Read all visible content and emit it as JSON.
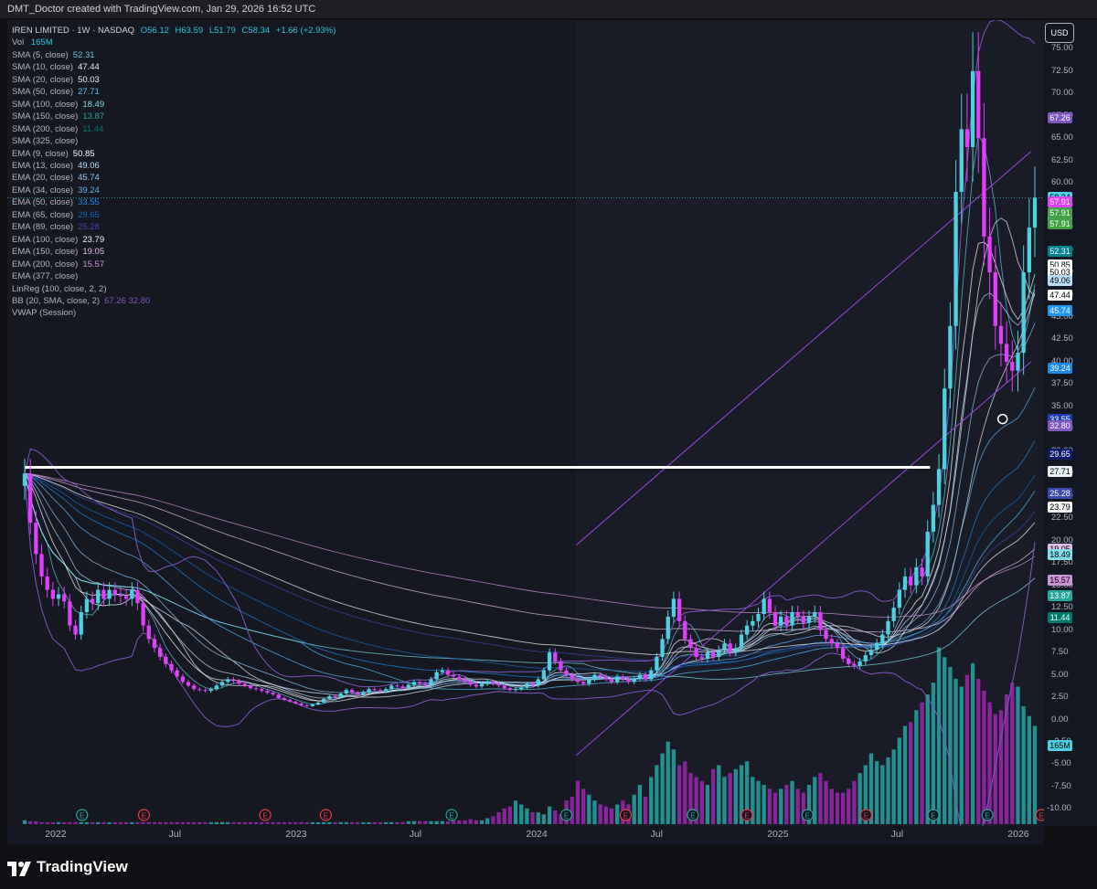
{
  "header": {
    "title": "DMT_Doctor created with TradingView.com, Jan 29, 2026 16:52 UTC"
  },
  "footer": {
    "logo_text": "TradingView"
  },
  "axis": {
    "currency_label": "USD"
  },
  "legend": {
    "symbol": "IREN LIMITED · 1W · NASDAQ",
    "ohlc": {
      "o": "O56.12",
      "h": "H63.59",
      "l": "L51.79",
      "c": "C58.34",
      "chg": "+1.66 (+2.93%)"
    },
    "volume": {
      "label": "Vol",
      "value": "165M"
    },
    "indicators": [
      {
        "label": "SMA (5, close)",
        "value": "52.31",
        "color": "#66c1e0"
      },
      {
        "label": "SMA (10, close)",
        "value": "47.44",
        "color": "#e8f2f5"
      },
      {
        "label": "SMA (20, close)",
        "value": "50.03",
        "color": "#e8f2f5"
      },
      {
        "label": "SMA (50, close)",
        "value": "27.71",
        "color": "#4fc3f7"
      },
      {
        "label": "SMA (100, close)",
        "value": "18.49",
        "color": "#80deea"
      },
      {
        "label": "SMA (150, close)",
        "value": "13.87",
        "color": "#26a69a"
      },
      {
        "label": "SMA (200, close)",
        "value": "11.44",
        "color": "#00796b"
      },
      {
        "label": "SMA (325, close)",
        "value": "",
        "color": "#b2b5be"
      },
      {
        "label": "EMA (9, close)",
        "value": "50.85",
        "color": "#ffffff"
      },
      {
        "label": "EMA (13, close)",
        "value": "49.06",
        "color": "#bbdefb"
      },
      {
        "label": "EMA (20, close)",
        "value": "45.74",
        "color": "#90caf9"
      },
      {
        "label": "EMA (34, close)",
        "value": "39.24",
        "color": "#64b5f6"
      },
      {
        "label": "EMA (50, close)",
        "value": "33.55",
        "color": "#1e88e5"
      },
      {
        "label": "EMA (65, close)",
        "value": "29.65",
        "color": "#1565c0"
      },
      {
        "label": "EMA (89, close)",
        "value": "25.28",
        "color": "#3949ab"
      },
      {
        "label": "EMA (100, close)",
        "value": "23.79",
        "color": "#f5f5f5"
      },
      {
        "label": "EMA (150, close)",
        "value": "19.05",
        "color": "#e1bee7"
      },
      {
        "label": "EMA (200, close)",
        "value": "15.57",
        "color": "#ce93d8"
      },
      {
        "label": "EMA (377, close)",
        "value": "",
        "color": "#b2b5be"
      },
      {
        "label": "LinReg (100, close, 2, 2)",
        "value": "",
        "color": "#b2b5be"
      },
      {
        "label": "BB (20, SMA, close, 2)",
        "value": "67.26  32.80",
        "color": "#7e57c2"
      },
      {
        "label": "VWAP (Session)",
        "value": "",
        "color": "#b2b5be"
      }
    ]
  },
  "colors": {
    "up": "#4dd0e1",
    "down": "#e040fb",
    "vol_up": "#26a6a6",
    "vol_down": "#9c27b0",
    "bb": "#7e57c2",
    "channel": "#9c47e8",
    "level": "#ffffff"
  },
  "chart_data": {
    "type": "candlestick",
    "symbol": "IREN LIMITED",
    "interval": "1W",
    "exchange": "NASDAQ",
    "y_ticks": [
      75,
      72.5,
      70,
      67.5,
      65,
      62.5,
      60,
      57.5,
      55,
      52.5,
      50,
      47.5,
      45,
      42.5,
      40,
      37.5,
      35,
      32.5,
      30,
      27.5,
      25,
      22.5,
      20,
      17.5,
      15,
      12.5,
      10,
      7.5,
      5,
      2.5,
      0,
      -2.5,
      -5,
      -7.5,
      -10
    ],
    "y_tick_labels": [
      "75.00",
      "72.50",
      "70.00",
      "67.50",
      "65.00",
      "62.50",
      "60.00",
      "57.50",
      "55.00",
      "52.50",
      "50.00",
      "47.50",
      "45.00",
      "42.50",
      "40.00",
      "37.50",
      "35.00",
      "32.50",
      "30.00",
      "27.50",
      "25.00",
      "22.50",
      "20.00",
      "17.50",
      "15.00",
      "12.50",
      "10.00",
      "7.50",
      "5.00",
      "2.50",
      "0.00",
      "-2.50",
      "-5.00",
      "-7.50",
      "-10.00"
    ],
    "x_tick_labels": [
      "2022",
      "Jul",
      "2023",
      "Jul",
      "2024",
      "Jul",
      "2025",
      "Jul",
      "2026"
    ],
    "x_tick_dates": [
      "2022-01-01",
      "2022-07-01",
      "2023-01-01",
      "2023-07-01",
      "2024-01-01",
      "2024-07-01",
      "2025-01-01",
      "2025-07-01",
      "2026-01-01"
    ],
    "date_range": [
      "2021-11-15",
      "2026-01-26"
    ],
    "horizontal_level": 28.2,
    "earnings_dates": [
      "2022-02-10",
      "2022-05-15",
      "2022-11-15",
      "2023-02-15",
      "2023-08-25",
      "2024-02-15",
      "2024-05-15",
      "2024-08-25",
      "2024-11-15",
      "2025-02-15",
      "2025-05-15",
      "2025-08-25",
      "2025-11-15",
      "2026-02-05"
    ],
    "closes": [
      [
        27.5,
        22.0,
        18.5,
        16.0,
        14.5,
        13.5,
        14.0,
        13.2,
        10.5,
        9.5,
        12.0,
        13.5,
        13.0,
        14.5,
        13.5,
        14.5,
        14.0,
        13.8,
        13.5,
        14.5,
        13.0,
        10.5,
        9.0,
        8.0,
        7.0,
        6.2,
        5.5,
        4.8,
        4.2,
        3.8,
        3.4,
        3.3,
        3.2,
        3.4,
        3.8,
        4.2,
        4.5,
        4.3,
        4.0,
        3.8,
        3.5,
        3.4,
        3.2,
        3.0,
        2.8,
        2.4,
        2.2,
        2.0,
        1.8,
        1.6,
        1.5,
        1.7,
        1.9,
        2.3,
        2.6,
        2.5,
        2.9,
        3.3,
        3.0,
        2.8,
        3.1,
        3.4,
        3.3,
        3.2,
        3.4,
        3.8,
        3.7,
        3.5,
        3.9,
        4.2,
        4.0,
        3.8,
        4.5,
        5.3,
        5.5,
        5.0,
        4.8,
        4.5,
        4.2,
        3.9,
        3.7,
        4.0,
        4.2,
        4.0,
        3.8,
        3.5,
        3.3,
        3.4,
        3.6,
        4.0,
        3.8,
        4.5,
        5.5,
        7.5,
        6.5,
        5.5,
        5.0,
        4.5,
        4.2,
        4.0,
        4.5,
        5.0,
        4.8,
        4.5,
        4.2,
        4.8,
        4.5,
        4.2,
        4.6,
        5.0,
        4.5,
        5.5,
        7.0,
        9.0,
        11.5,
        13.5,
        11.0,
        9.0,
        8.0,
        7.0,
        6.8,
        7.5,
        7.0,
        7.8,
        8.5,
        7.5,
        8.0,
        9.5,
        10.5,
        11.0,
        11.8,
        13.5,
        12.0,
        10.5,
        11.5,
        10.5,
        12.0,
        11.5,
        10.8,
        11.5,
        12.0,
        10.0,
        9.0,
        8.5,
        8.0,
        6.8,
        6.2,
        6.0,
        6.5,
        7.2,
        7.8,
        8.5,
        9.5,
        11.0,
        12.5,
        14.5,
        16.0,
        15.0,
        17.0,
        16.0,
        21.0,
        24.0,
        28.0,
        37.0,
        44.0,
        59.0,
        66.0,
        64.0,
        72.5,
        65.0,
        54.0,
        50.0,
        44.0,
        42.0,
        40.0,
        39.0,
        41.0,
        50.0,
        55.0,
        58.34
      ]
    ],
    "series": [
      {
        "name": "IREN LIMITED",
        "values": [
          27.5,
          22.0,
          18.5,
          16.0,
          14.5,
          13.5,
          14.0,
          13.2,
          10.5,
          9.5,
          12.0,
          13.5,
          13.0,
          14.5,
          13.5,
          14.5,
          14.0,
          13.8,
          13.5,
          14.5,
          13.0,
          10.5,
          9.0,
          8.0,
          7.0,
          6.2,
          5.5,
          4.8,
          4.2,
          3.8,
          3.4,
          3.3,
          3.2,
          3.4,
          3.8,
          4.2,
          4.5,
          4.3,
          4.0,
          3.8,
          3.5,
          3.4,
          3.2,
          3.0,
          2.8,
          2.4,
          2.2,
          2.0,
          1.8,
          1.6,
          1.5,
          1.7,
          1.9,
          2.3,
          2.6,
          2.5,
          2.9,
          3.3,
          3.0,
          2.8,
          3.1,
          3.4,
          3.3,
          3.2,
          3.4,
          3.8,
          3.7,
          3.5,
          3.9,
          4.2,
          4.0,
          3.8,
          4.5,
          5.3,
          5.5,
          5.0,
          4.8,
          4.5,
          4.2,
          3.9,
          3.7,
          4.0,
          4.2,
          4.0,
          3.8,
          3.5,
          3.3,
          3.4,
          3.6,
          4.0,
          3.8,
          4.5,
          5.5,
          7.5,
          6.5,
          5.5,
          5.0,
          4.5,
          4.2,
          4.0,
          4.5,
          5.0,
          4.8,
          4.5,
          4.2,
          4.8,
          4.5,
          4.2,
          4.6,
          5.0,
          4.5,
          5.5,
          7.0,
          9.0,
          11.5,
          13.5,
          11.0,
          9.0,
          8.0,
          7.0,
          6.8,
          7.5,
          7.0,
          7.8,
          8.5,
          7.5,
          8.0,
          9.5,
          10.5,
          11.0,
          11.8,
          13.5,
          12.0,
          10.5,
          11.5,
          10.5,
          12.0,
          11.5,
          10.8,
          11.5,
          12.0,
          10.0,
          9.0,
          8.5,
          8.0,
          6.8,
          6.2,
          6.0,
          6.5,
          7.2,
          7.8,
          8.5,
          9.5,
          11.0,
          12.5,
          14.5,
          16.0,
          15.0,
          17.0,
          16.0,
          21.0,
          24.0,
          28.0,
          37.0,
          44.0,
          59.0,
          66.0,
          64.0,
          72.5,
          65.0,
          54.0,
          50.0,
          44.0,
          42.0,
          40.0,
          39.0,
          41.0,
          50.0,
          55.0,
          58.34
        ]
      }
    ],
    "volume_bars_relative": [
      0.02,
      0.015,
      0.015,
      0.01,
      0.01,
      0.01,
      0.01,
      0.01,
      0.01,
      0.01,
      0.01,
      0.01,
      0.01,
      0.01,
      0.01,
      0.01,
      0.01,
      0.01,
      0.01,
      0.01,
      0.01,
      0.01,
      0.01,
      0.01,
      0.01,
      0.01,
      0.01,
      0.01,
      0.01,
      0.01,
      0.01,
      0.01,
      0.01,
      0.01,
      0.01,
      0.01,
      0.01,
      0.01,
      0.01,
      0.01,
      0.01,
      0.01,
      0.01,
      0.01,
      0.01,
      0.01,
      0.01,
      0.01,
      0.01,
      0.01,
      0.01,
      0.01,
      0.01,
      0.01,
      0.01,
      0.01,
      0.01,
      0.01,
      0.01,
      0.01,
      0.01,
      0.01,
      0.01,
      0.01,
      0.01,
      0.01,
      0.01,
      0.01,
      0.015,
      0.015,
      0.015,
      0.015,
      0.015,
      0.015,
      0.015,
      0.015,
      0.02,
      0.02,
      0.02,
      0.025,
      0.02,
      0.02,
      0.03,
      0.04,
      0.06,
      0.08,
      0.09,
      0.12,
      0.1,
      0.08,
      0.06,
      0.06,
      0.05,
      0.09,
      0.07,
      0.05,
      0.12,
      0.14,
      0.22,
      0.18,
      0.15,
      0.12,
      0.1,
      0.09,
      0.08,
      0.1,
      0.12,
      0.1,
      0.15,
      0.2,
      0.14,
      0.24,
      0.3,
      0.36,
      0.42,
      0.38,
      0.3,
      0.32,
      0.26,
      0.24,
      0.22,
      0.2,
      0.28,
      0.3,
      0.24,
      0.26,
      0.28,
      0.3,
      0.32,
      0.24,
      0.22,
      0.2,
      0.18,
      0.16,
      0.18,
      0.2,
      0.22,
      0.18,
      0.16,
      0.2,
      0.24,
      0.26,
      0.22,
      0.18,
      0.16,
      0.16,
      0.18,
      0.22,
      0.26,
      0.3,
      0.36,
      0.32,
      0.3,
      0.34,
      0.38,
      0.44,
      0.5,
      0.52,
      0.58,
      0.62,
      0.66,
      0.72,
      0.9,
      0.85,
      0.8,
      0.74,
      0.7,
      0.76,
      0.82,
      0.74,
      0.68,
      0.62,
      0.56,
      0.58,
      0.66,
      0.72,
      0.7,
      0.6,
      0.55,
      0.5
    ]
  }
}
